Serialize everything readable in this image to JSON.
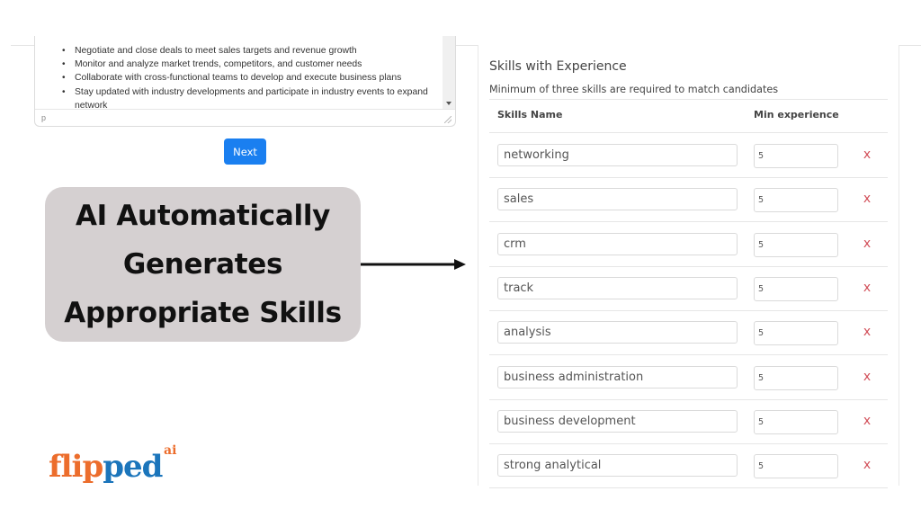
{
  "editor": {
    "bullets": [
      "Negotiate and close deals to meet sales targets and revenue growth",
      "Monitor and analyze market trends, competitors, and customer needs",
      "Collaborate with cross-functional teams to develop and execute business plans",
      "Stay updated with industry developments and participate in industry events to expand network"
    ],
    "status_path": "p"
  },
  "next_button": {
    "label": "Next"
  },
  "callout": {
    "lines": [
      "AI Automatically",
      "Generates",
      "Appropriate Skills"
    ]
  },
  "logo": {
    "text_orange": "flip",
    "text_blue": "ped",
    "superscript": "ai",
    "colors": {
      "orange": "#ec6d2c",
      "blue": "#1b75bb"
    }
  },
  "skills_panel": {
    "title": "Skills with Experience",
    "subtitle": "Minimum of three skills are required to match candidates",
    "columns": {
      "skill": "Skills Name",
      "experience": "Min experience"
    },
    "remove_label": "x",
    "remove_color": "#d2505a",
    "rows": [
      {
        "skill": "networking",
        "experience": "5"
      },
      {
        "skill": "sales",
        "experience": "5"
      },
      {
        "skill": "crm",
        "experience": "5"
      },
      {
        "skill": "track",
        "experience": "5"
      },
      {
        "skill": "analysis",
        "experience": "5"
      },
      {
        "skill": "business administration",
        "experience": "5"
      },
      {
        "skill": "business development",
        "experience": "5"
      },
      {
        "skill": "strong analytical",
        "experience": "5"
      }
    ]
  },
  "accent_color": "#1a7ff0"
}
